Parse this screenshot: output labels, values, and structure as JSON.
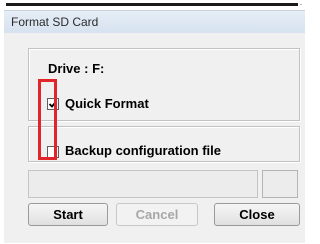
{
  "window": {
    "title": "Format SD Card"
  },
  "drive": {
    "label": "Drive : F:"
  },
  "options": {
    "quick_format": {
      "label": "Quick Format",
      "checked": true
    },
    "backup_config": {
      "label": "Backup configuration file",
      "checked": false
    }
  },
  "buttons": {
    "start_label": "Start",
    "cancel_label": "Cancel",
    "close_label": "Close"
  },
  "colors": {
    "highlight": "#e0262b",
    "disabled_text": "#a7a7a7"
  }
}
